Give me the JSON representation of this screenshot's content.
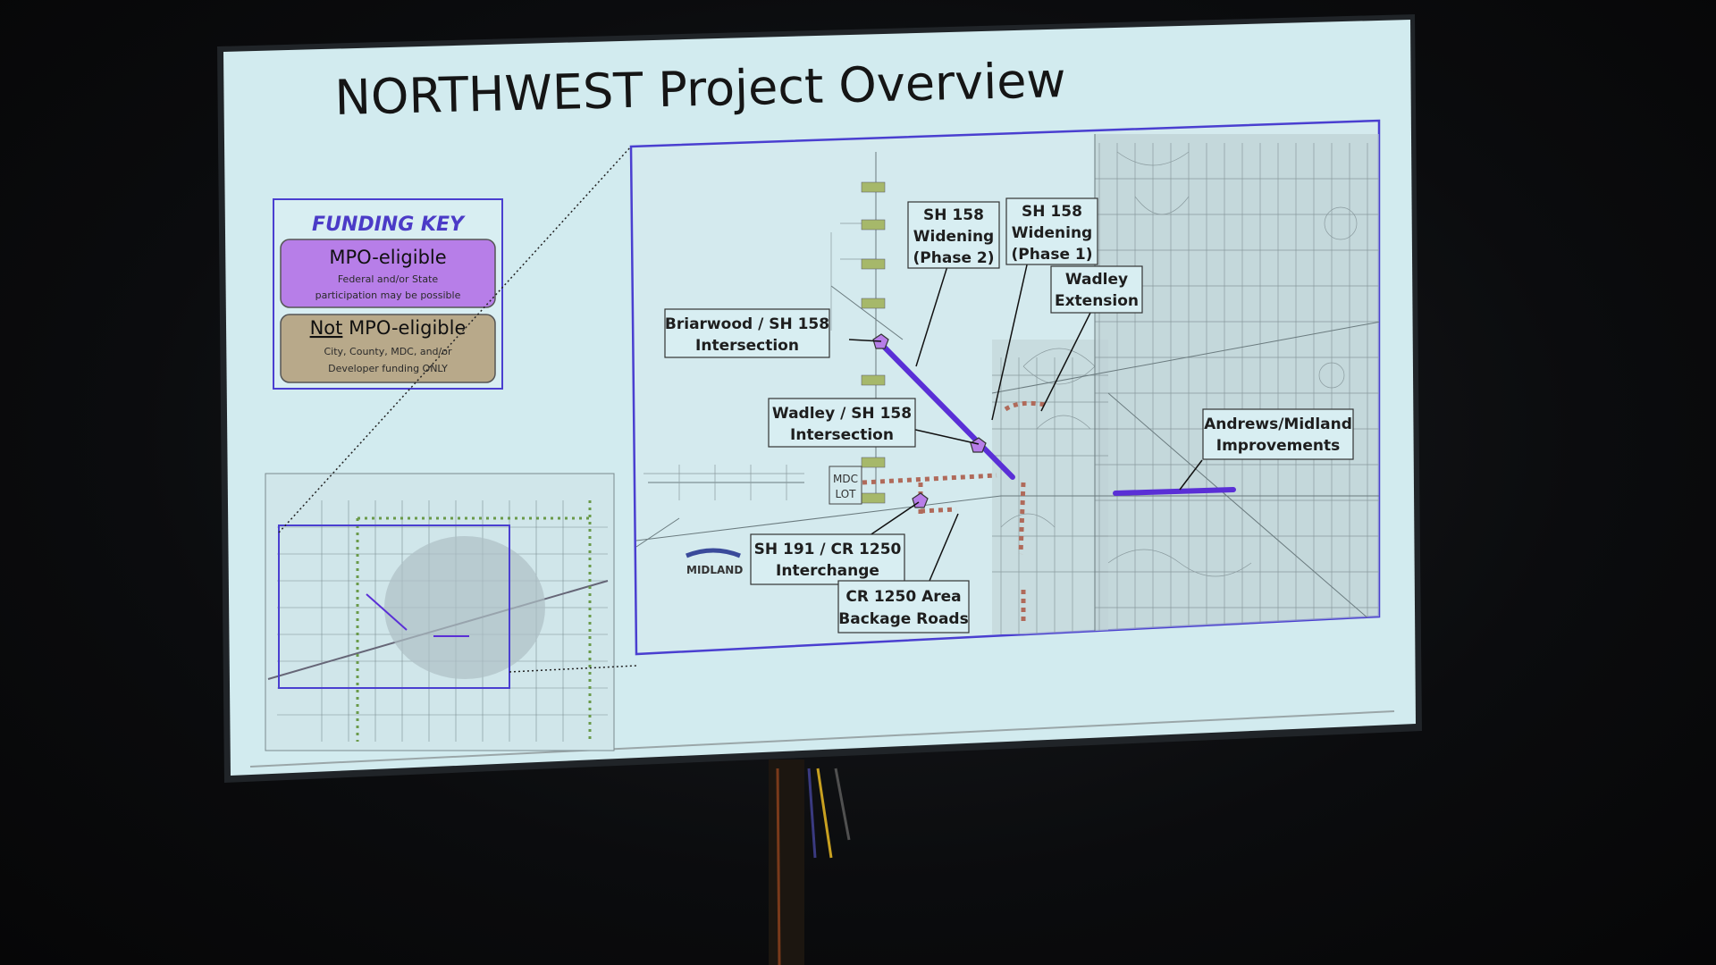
{
  "slide": {
    "title": "NORTHWEST Project Overview"
  },
  "funding_key": {
    "title": "FUNDING KEY",
    "mpo": {
      "label": "MPO-eligible",
      "desc_line1": "Federal and/or State",
      "desc_line2": "participation may be possible",
      "color": "#b77ee8"
    },
    "not_mpo": {
      "label_prefix": "Not",
      "label_rest": " MPO-eligible",
      "desc_line1": "City, County, MDC, and/or",
      "desc_line2": "Developer funding ONLY",
      "color": "#b8a98a"
    }
  },
  "map": {
    "logo": "MIDLAND",
    "mdc_lot": [
      "MDC",
      "LOT"
    ],
    "callouts": {
      "sh158_phase2": [
        "SH 158",
        "Widening",
        "(Phase 2)"
      ],
      "sh158_phase1": [
        "SH 158",
        "Widening",
        "(Phase 1)"
      ],
      "wadley_ext": [
        "Wadley",
        "Extension"
      ],
      "briarwood": [
        "Briarwood / SH 158",
        "Intersection"
      ],
      "wadley_sh158": [
        "Wadley / SH 158",
        "Intersection"
      ],
      "andrews": [
        "Andrews/Midland",
        "Improvements"
      ],
      "sh191": [
        "SH 191 / CR 1250",
        "Interchange"
      ],
      "cr1250": [
        "CR 1250 Area",
        "Backage Roads"
      ]
    }
  },
  "colors": {
    "accent_purple": "#5a2fd6",
    "dotted_brown": "#b06a5a",
    "frame_blue": "#4a3fd0"
  }
}
